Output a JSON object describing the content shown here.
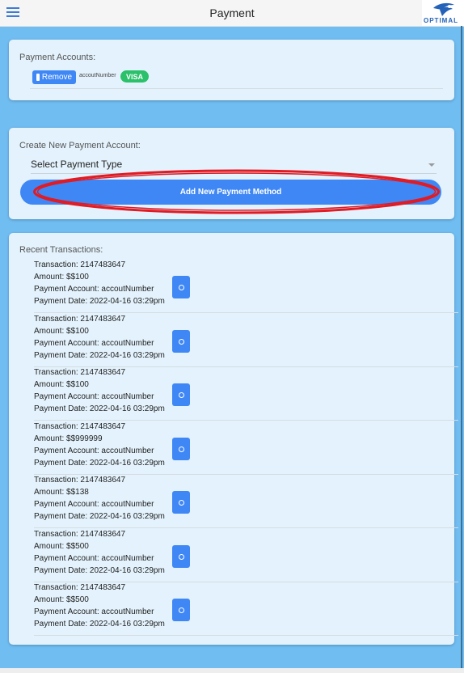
{
  "header": {
    "title": "Payment",
    "logo_text": "OPTIMAL"
  },
  "payment_accounts": {
    "label": "Payment Accounts:",
    "accounts": [
      {
        "remove_label": "Remove",
        "account_number": "accoutNumber",
        "card_type": "VISA"
      }
    ]
  },
  "create_account": {
    "label": "Create New Payment Account:",
    "select_value": "Select Payment Type",
    "add_button_label": "Add New Payment Method"
  },
  "transactions": {
    "label": "Recent Transactions:",
    "items": [
      {
        "id": "Transaction: 2147483647",
        "amount": "Amount: $$100",
        "account": "Payment Account: accoutNumber",
        "date": "Payment Date: 2022-04-16 03:29pm"
      },
      {
        "id": "Transaction: 2147483647",
        "amount": "Amount: $$100",
        "account": "Payment Account: accoutNumber",
        "date": "Payment Date: 2022-04-16 03:29pm"
      },
      {
        "id": "Transaction: 2147483647",
        "amount": "Amount: $$100",
        "account": "Payment Account: accoutNumber",
        "date": "Payment Date: 2022-04-16 03:29pm"
      },
      {
        "id": "Transaction: 2147483647",
        "amount": "Amount: $$999999",
        "account": "Payment Account: accoutNumber",
        "date": "Payment Date: 2022-04-16 03:29pm"
      },
      {
        "id": "Transaction: 2147483647",
        "amount": "Amount: $$138",
        "account": "Payment Account: accoutNumber",
        "date": "Payment Date: 2022-04-16 03:29pm"
      },
      {
        "id": "Transaction: 2147483647",
        "amount": "Amount: $$500",
        "account": "Payment Account: accoutNumber",
        "date": "Payment Date: 2022-04-16 03:29pm"
      },
      {
        "id": "Transaction: 2147483647",
        "amount": "Amount: $$500",
        "account": "Payment Account: accoutNumber",
        "date": "Payment Date: 2022-04-16 03:29pm"
      }
    ]
  },
  "colors": {
    "background": "#70bdf2",
    "card": "#e3f2fc",
    "primary": "#3f87f5",
    "visa_badge": "#2bc06a",
    "annotation": "#e01b24"
  },
  "icons": {
    "menu": "hamburger-icon",
    "view": "search-icon",
    "card": "credit-card-icon"
  }
}
